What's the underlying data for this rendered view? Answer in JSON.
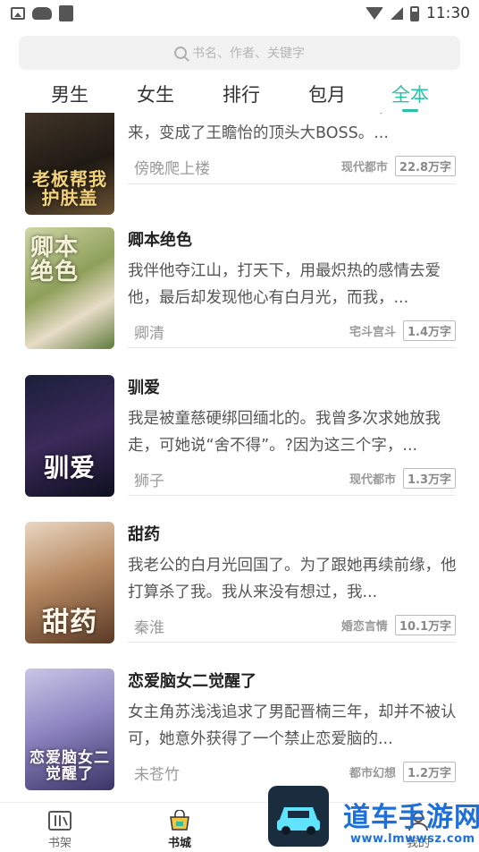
{
  "status_bar": {
    "time": "11:30"
  },
  "search": {
    "placeholder": "书名、作者、关键字"
  },
  "tabs": [
    {
      "label": "男生"
    },
    {
      "label": "女生"
    },
    {
      "label": "排行"
    },
    {
      "label": "包月"
    },
    {
      "label": "全本",
      "active": true
    }
  ],
  "books": [
    {
      "title": "",
      "cover_text": "老板帮我\n护肤盖",
      "description": "网恋对象七年前失约出国，音讯全无；七年后回来，变成了王瞻怡的顶头大BOSS。...",
      "author": "傍晚爬上楼",
      "genre": "现代都市",
      "words": "22.8万字"
    },
    {
      "title": "卿本绝色",
      "cover_text": "卿本\n绝色",
      "description": "我伴他夺江山，打天下，用最炽热的感情去爱他，最后却发现他心有白月光，而我，...",
      "author": "卿清",
      "genre": "宅斗宫斗",
      "words": "1.4万字"
    },
    {
      "title": "驯爱",
      "cover_text": "驯爱",
      "description": "我是被童慈硬绑回缅北的。我曾多次求她放我走，可她说“舍不得”。?因为这三个字，...",
      "author": "狮子",
      "genre": "现代都市",
      "words": "1.3万字"
    },
    {
      "title": "甜药",
      "cover_text": "甜药",
      "description": "我老公的白月光回国了。为了跟她再续前缘，他打算杀了我。我从来没有想过，我...",
      "author": "秦淮",
      "genre": "婚恋言情",
      "words": "10.1万字"
    },
    {
      "title": "恋爱脑女二觉醒了",
      "cover_text": "恋爱脑女二\n觉醒了",
      "description": "女主角苏浅浅追求了男配晋楠三年，却并不被认可，她意外获得了一个禁止恋爱脑的...",
      "author": "未苍竹",
      "genre": "都市幻想",
      "words": "1.2万字"
    }
  ],
  "bottom_nav": [
    {
      "label": "书架"
    },
    {
      "label": "书城",
      "active": true
    },
    {
      "label": "我的"
    }
  ],
  "watermark": {
    "text": "道车手游网",
    "url": "www.lmwwsz.com"
  },
  "colors": {
    "accent": "#2bbfa6",
    "watermark": "#1e6fd8"
  }
}
